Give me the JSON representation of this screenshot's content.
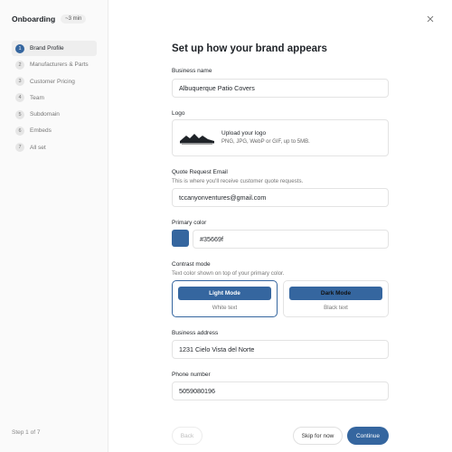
{
  "sidebar": {
    "title": "Onboarding",
    "badge": "~3 min",
    "steps": [
      {
        "num": "1",
        "label": "Brand Profile",
        "active": true
      },
      {
        "num": "2",
        "label": "Manufacturers & Parts"
      },
      {
        "num": "3",
        "label": "Customer Pricing"
      },
      {
        "num": "4",
        "label": "Team"
      },
      {
        "num": "5",
        "label": "Subdomain"
      },
      {
        "num": "6",
        "label": "Embeds"
      },
      {
        "num": "7",
        "label": "All set"
      }
    ],
    "footer": "Step 1 of 7"
  },
  "main": {
    "title": "Set up how your brand appears",
    "business_name": {
      "label": "Business name",
      "value": "Albuquerque Patio Covers"
    },
    "logo": {
      "label": "Logo",
      "upload_title": "Upload your logo",
      "upload_hint": "PNG, JPG, WebP or GIF, up to 5MB."
    },
    "quote_email": {
      "label": "Quote Request Email",
      "help": "This is where you'll receive customer quote requests.",
      "value": "tccanyonventures@gmail.com"
    },
    "primary_color": {
      "label": "Primary color",
      "value": "#35669f"
    },
    "contrast": {
      "label": "Contrast mode",
      "help": "Text color shown on top of your primary color.",
      "light": {
        "button": "Light Mode",
        "caption": "White text"
      },
      "dark": {
        "button": "Dark Mode",
        "caption": "Black text"
      }
    },
    "address": {
      "label": "Business address",
      "value": "1231 Cielo Vista del Norte"
    },
    "phone": {
      "label": "Phone number",
      "value": "5059080196"
    }
  },
  "footer": {
    "back": "Back",
    "skip": "Skip for now",
    "continue": "Continue"
  },
  "colors": {
    "accent": "#35669f"
  },
  "icons": {
    "close": "close-icon"
  }
}
